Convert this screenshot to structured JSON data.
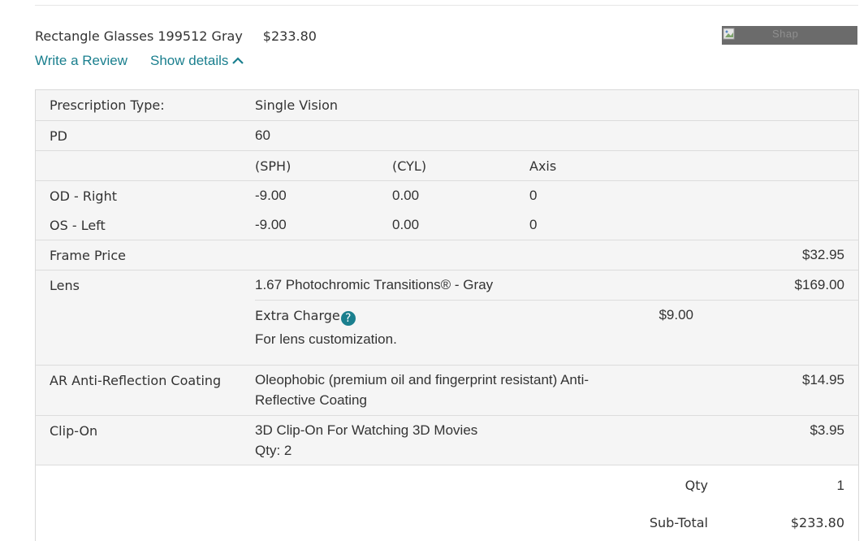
{
  "product": {
    "name": "Rectangle Glasses 199512 Gray",
    "price": "$233.80",
    "write_review": "Write a Review",
    "show_details": "Show details",
    "image_alt": "Shap"
  },
  "prescription": {
    "type_label": "Prescription Type:",
    "type_value": "Single Vision",
    "pd_label": "PD",
    "pd_value": "60",
    "headers": [
      "(SPH)",
      "(CYL)",
      "Axis"
    ],
    "od": {
      "label": "OD - Right",
      "sph": "-9.00",
      "cyl": "0.00",
      "axis": "0"
    },
    "os": {
      "label": "OS - Left",
      "sph": "-9.00",
      "cyl": "0.00",
      "axis": "0"
    }
  },
  "frame": {
    "label": "Frame Price",
    "price": "$32.95"
  },
  "lens": {
    "label": "Lens",
    "value": "1.67 Photochromic Transitions® - Gray",
    "price": "$169.00",
    "extra_label": "Extra Charge",
    "extra_price": "$9.00",
    "extra_note": "For lens customization."
  },
  "coating": {
    "label": "AR Anti-Reflection Coating",
    "value_line1": "Oleophobic (premium oil and fingerprint resistant) Anti-",
    "value_line2": "Reflective Coating",
    "price": "$14.95"
  },
  "clip_on": {
    "label": "Clip-On",
    "value": "3D Clip-On For Watching 3D Movies",
    "qty": "Qty: 2",
    "price": "$3.95"
  },
  "summary": {
    "qty_label": "Qty",
    "qty_value": "1",
    "subtotal_label": "Sub-Total",
    "subtotal_value": "$233.80"
  },
  "colors": {
    "link": "#1a7f8e",
    "row_bg": "#f5f5f5",
    "border": "#dcdcdc"
  },
  "icons": [
    "chevron-up-icon",
    "help-icon",
    "broken-image-icon"
  ]
}
